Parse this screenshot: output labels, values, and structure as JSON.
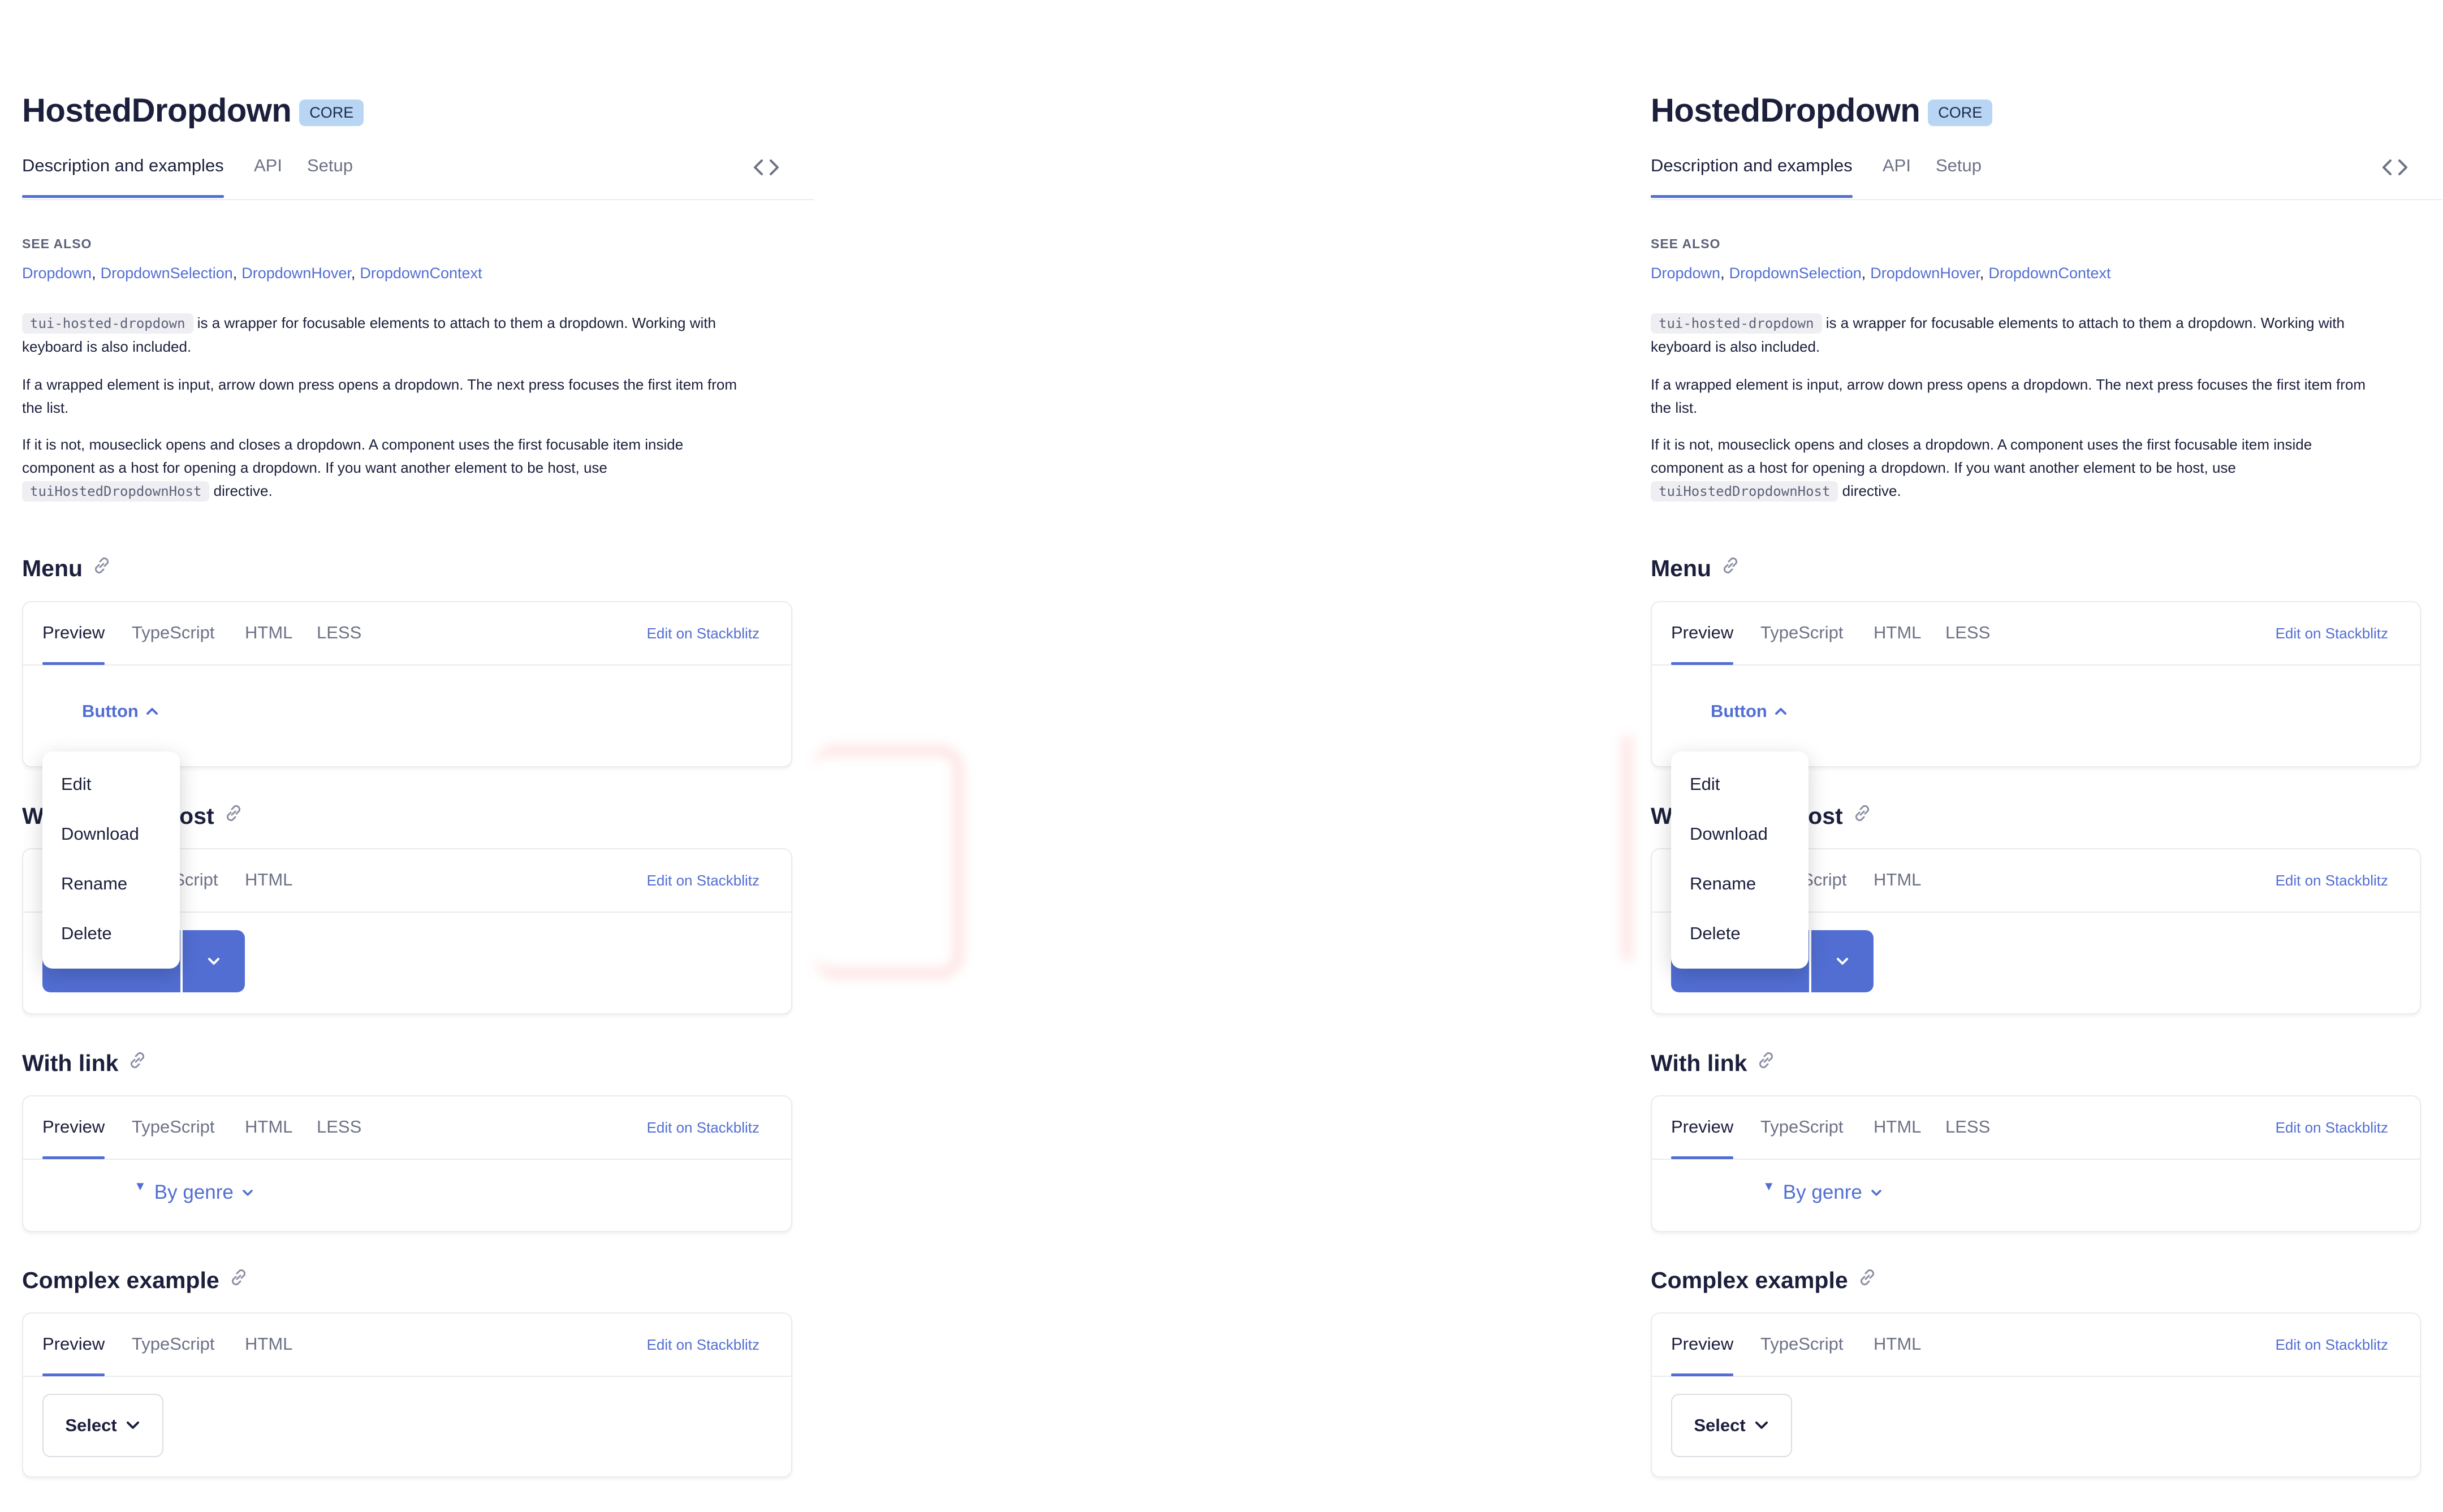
{
  "panels": [
    {
      "title": "HostedDropdown",
      "badge": "CORE",
      "tabs": [
        "Description and examples",
        "API",
        "Setup"
      ],
      "see_also": {
        "label": "SEE ALSO",
        "links": [
          "Dropdown",
          "DropdownSelection",
          "DropdownHover",
          "DropdownContext"
        ]
      },
      "description": {
        "code1": "tui-hosted-dropdown",
        "p1_rest_a": " is a wrapper for focusable elements to attach to them a dropdown. Working with",
        "p1_rest_b": "keyboard is also included.",
        "p2_a": "If a wrapped element is input, arrow down press opens a dropdown. The next press focuses the first item from",
        "p2_b": "the list.",
        "p3_a": "If it is not, mouseclick opens and closes a dropdown. A component uses the first focusable item inside",
        "p3_b": "component as a host for opening a dropdown. If you want another element to be host, use",
        "code2": "tuiHostedDropdownHost",
        "p3_c": " directive."
      },
      "sections": {
        "menu": {
          "title": "Menu",
          "tabs": [
            "Preview",
            "TypeScript",
            "HTML",
            "LESS"
          ],
          "stackblitz": "Edit on Stackblitz",
          "button_label": "Button"
        },
        "host": {
          "title_left": "W",
          "title_right": "n host",
          "tabs": [
            "TypeScript",
            "HTML"
          ],
          "tab_partial": "eScript",
          "stackblitz": "Edit on Stackblitz"
        },
        "link": {
          "title": "With link",
          "tabs": [
            "Preview",
            "TypeScript",
            "HTML",
            "LESS"
          ],
          "stackblitz": "Edit on Stackblitz",
          "link_label": "By genre",
          "caret": "▼"
        },
        "complex": {
          "title": "Complex example",
          "tabs": [
            "Preview",
            "TypeScript",
            "HTML"
          ],
          "stackblitz": "Edit on Stackblitz",
          "select_label": "Select"
        }
      },
      "dropdown_items": [
        "Edit",
        "Download",
        "Rename",
        "Delete"
      ]
    }
  ],
  "colors": {
    "accent": "#526ed3",
    "text": "#1b1f3b",
    "muted": "#6d7186",
    "badge": "#b8d6f4"
  }
}
